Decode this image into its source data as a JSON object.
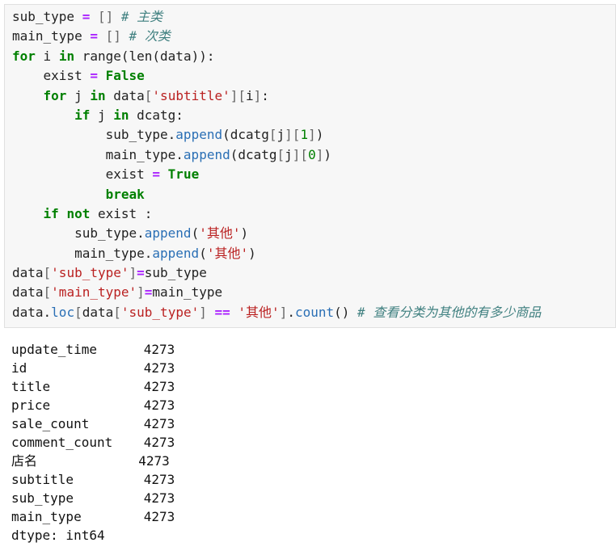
{
  "code_lines": [
    [
      {
        "t": "sub_type ",
        "c": ""
      },
      {
        "t": "=",
        "c": "o"
      },
      {
        "t": " [] ",
        "c": "p"
      },
      {
        "t": "# 主类",
        "c": "c"
      }
    ],
    [
      {
        "t": "main_type ",
        "c": ""
      },
      {
        "t": "=",
        "c": "o"
      },
      {
        "t": " [] ",
        "c": "p"
      },
      {
        "t": "# 次类",
        "c": "c"
      }
    ],
    [
      {
        "t": "for",
        "c": "k"
      },
      {
        "t": " i ",
        "c": ""
      },
      {
        "t": "in",
        "c": "k"
      },
      {
        "t": " range(len(data)):",
        "c": ""
      }
    ],
    [
      {
        "t": "    exist ",
        "c": ""
      },
      {
        "t": "=",
        "c": "o"
      },
      {
        "t": " ",
        "c": ""
      },
      {
        "t": "False",
        "c": "k"
      }
    ],
    [
      {
        "t": "    ",
        "c": ""
      },
      {
        "t": "for",
        "c": "k"
      },
      {
        "t": " j ",
        "c": ""
      },
      {
        "t": "in",
        "c": "k"
      },
      {
        "t": " data",
        "c": ""
      },
      {
        "t": "[",
        "c": "p"
      },
      {
        "t": "'subtitle'",
        "c": "s"
      },
      {
        "t": "][",
        "c": "p"
      },
      {
        "t": "i",
        "c": ""
      },
      {
        "t": "]",
        "c": "p"
      },
      {
        "t": ":",
        "c": ""
      }
    ],
    [
      {
        "t": "        ",
        "c": ""
      },
      {
        "t": "if",
        "c": "k"
      },
      {
        "t": " j ",
        "c": ""
      },
      {
        "t": "in",
        "c": "k"
      },
      {
        "t": " dcatg:",
        "c": ""
      }
    ],
    [
      {
        "t": "            sub_type.",
        "c": ""
      },
      {
        "t": "append",
        "c": "m"
      },
      {
        "t": "(dcatg",
        "c": ""
      },
      {
        "t": "[",
        "c": "p"
      },
      {
        "t": "j",
        "c": ""
      },
      {
        "t": "][",
        "c": "p"
      },
      {
        "t": "1",
        "c": "n"
      },
      {
        "t": "]",
        "c": "p"
      },
      {
        "t": ")",
        "c": ""
      }
    ],
    [
      {
        "t": "            main_type.",
        "c": ""
      },
      {
        "t": "append",
        "c": "m"
      },
      {
        "t": "(dcatg",
        "c": ""
      },
      {
        "t": "[",
        "c": "p"
      },
      {
        "t": "j",
        "c": ""
      },
      {
        "t": "][",
        "c": "p"
      },
      {
        "t": "0",
        "c": "n"
      },
      {
        "t": "]",
        "c": "p"
      },
      {
        "t": ")",
        "c": ""
      }
    ],
    [
      {
        "t": "            exist ",
        "c": ""
      },
      {
        "t": "=",
        "c": "o"
      },
      {
        "t": " ",
        "c": ""
      },
      {
        "t": "True",
        "c": "k"
      }
    ],
    [
      {
        "t": "            ",
        "c": ""
      },
      {
        "t": "break",
        "c": "k"
      }
    ],
    [
      {
        "t": "    ",
        "c": ""
      },
      {
        "t": "if",
        "c": "k"
      },
      {
        "t": " ",
        "c": ""
      },
      {
        "t": "not",
        "c": "k"
      },
      {
        "t": " exist :",
        "c": ""
      }
    ],
    [
      {
        "t": "        sub_type.",
        "c": ""
      },
      {
        "t": "append",
        "c": "m"
      },
      {
        "t": "(",
        "c": ""
      },
      {
        "t": "'其他'",
        "c": "s"
      },
      {
        "t": ")",
        "c": ""
      }
    ],
    [
      {
        "t": "        main_type.",
        "c": ""
      },
      {
        "t": "append",
        "c": "m"
      },
      {
        "t": "(",
        "c": ""
      },
      {
        "t": "'其他'",
        "c": "s"
      },
      {
        "t": ")",
        "c": ""
      }
    ],
    [
      {
        "t": "data",
        "c": ""
      },
      {
        "t": "[",
        "c": "p"
      },
      {
        "t": "'sub_type'",
        "c": "s"
      },
      {
        "t": "]",
        "c": "p"
      },
      {
        "t": "=",
        "c": "o"
      },
      {
        "t": "sub_type",
        "c": ""
      }
    ],
    [
      {
        "t": "data",
        "c": ""
      },
      {
        "t": "[",
        "c": "p"
      },
      {
        "t": "'main_type'",
        "c": "s"
      },
      {
        "t": "]",
        "c": "p"
      },
      {
        "t": "=",
        "c": "o"
      },
      {
        "t": "main_type",
        "c": ""
      }
    ],
    [
      {
        "t": "data.",
        "c": ""
      },
      {
        "t": "loc",
        "c": "m"
      },
      {
        "t": "[",
        "c": "p"
      },
      {
        "t": "data",
        "c": ""
      },
      {
        "t": "[",
        "c": "p"
      },
      {
        "t": "'sub_type'",
        "c": "s"
      },
      {
        "t": "]",
        "c": "p"
      },
      {
        "t": " ",
        "c": ""
      },
      {
        "t": "==",
        "c": "o"
      },
      {
        "t": " ",
        "c": ""
      },
      {
        "t": "'其他'",
        "c": "s"
      },
      {
        "t": "]",
        "c": "p"
      },
      {
        "t": ".",
        "c": ""
      },
      {
        "t": "count",
        "c": "m"
      },
      {
        "t": "() ",
        "c": ""
      },
      {
        "t": "# 查看分类为其他的有多少商品",
        "c": "c"
      }
    ]
  ],
  "output_rows": [
    {
      "label": "update_time",
      "value": "4273"
    },
    {
      "label": "id",
      "value": "4273"
    },
    {
      "label": "title",
      "value": "4273"
    },
    {
      "label": "price",
      "value": "4273"
    },
    {
      "label": "sale_count",
      "value": "4273"
    },
    {
      "label": "comment_count",
      "value": "4273"
    },
    {
      "label": "店名",
      "value": "4273"
    },
    {
      "label": "subtitle",
      "value": "4273"
    },
    {
      "label": "sub_type",
      "value": "4273"
    },
    {
      "label": "main_type",
      "value": "4273"
    }
  ],
  "dtype_line": "dtype: int64"
}
